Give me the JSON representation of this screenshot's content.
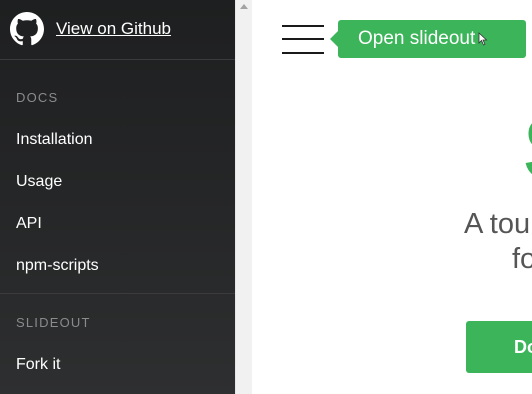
{
  "sidebar": {
    "github_link": "View on Github",
    "sections": [
      {
        "title": "DOCS",
        "items": [
          "Installation",
          "Usage",
          "API",
          "npm-scripts"
        ]
      },
      {
        "title": "SLIDEOUT",
        "items": [
          "Fork it"
        ]
      }
    ]
  },
  "main": {
    "tooltip": "Open slideout",
    "hero_logo_partial": "S",
    "hero_line_1": "A tou",
    "hero_line_2": "fo",
    "cta_partial": "Do"
  },
  "icons": {
    "github": "github-octocat-icon",
    "menu": "hamburger-menu-icon",
    "cursor": "mouse-cursor-icon",
    "scroll_up": "scroll-up-arrow-icon"
  },
  "colors": {
    "sidebar_bg": "#262728",
    "accent_green": "#3cb55a",
    "section_title": "#8a8b8c",
    "hero_text": "#555555"
  }
}
